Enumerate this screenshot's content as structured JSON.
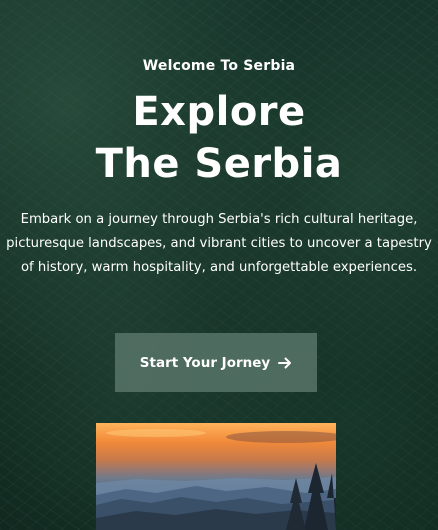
{
  "hero": {
    "eyebrow": "Welcome To Serbia",
    "title_line1": "Explore",
    "title_line2": "The Serbia",
    "description": "Embark on a journey through Serbia's rich cultural heritage, picturesque landscapes, and vibrant cities to uncover a tapestry of history, warm hospitality, and unforgettable experiences.",
    "cta_label": "Start Your Jorney",
    "cta_icon": "arrow-right-icon"
  },
  "colors": {
    "background": "#16332a",
    "button_bg": "#58746a",
    "text": "#ffffff",
    "sunset_orange": "#f0893a"
  }
}
